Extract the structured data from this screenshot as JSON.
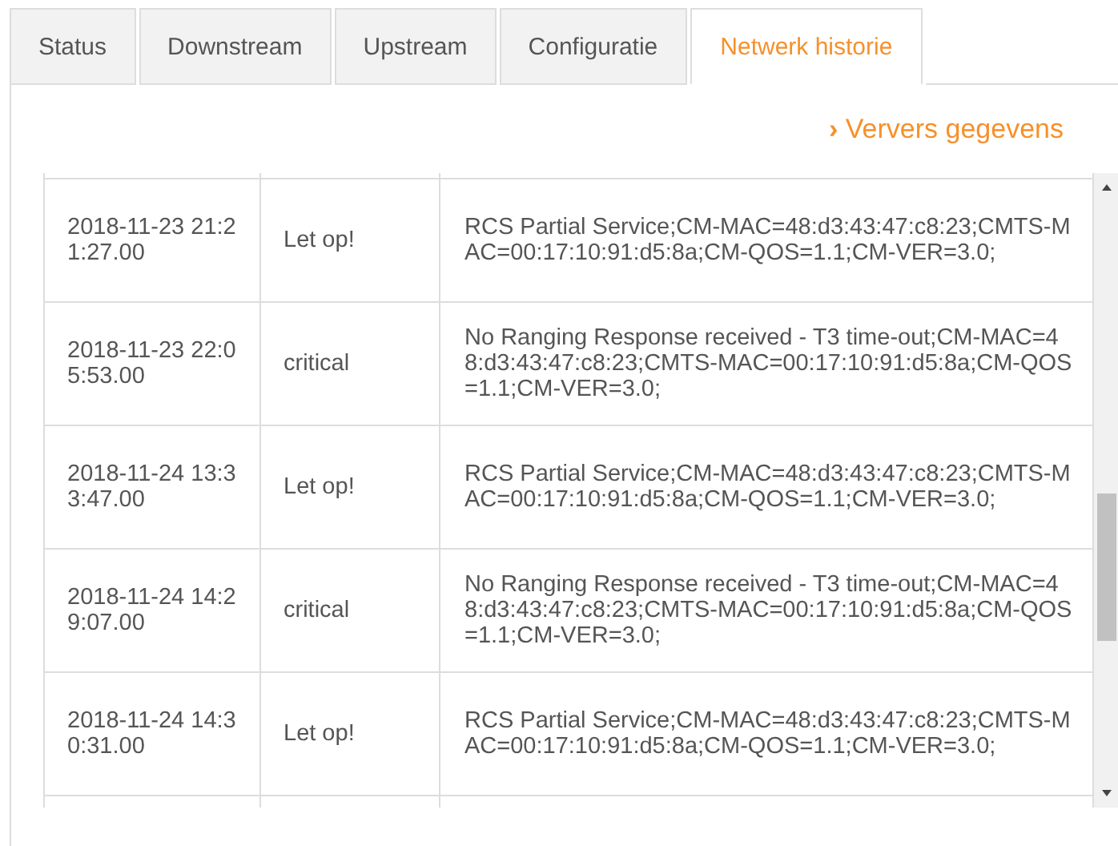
{
  "tabs": [
    {
      "label": "Status",
      "selected": false
    },
    {
      "label": "Downstream",
      "selected": false
    },
    {
      "label": "Upstream",
      "selected": false
    },
    {
      "label": "Configuratie",
      "selected": false
    },
    {
      "label": "Netwerk historie",
      "selected": true
    }
  ],
  "refresh_link": {
    "icon": "›",
    "label": "Ververs gegevens"
  },
  "table": {
    "rows": [
      {
        "time": "2018-11-23 21:21:27.00",
        "level": "Let op!",
        "message": "RCS Partial Service;CM-MAC=48:d3:43:47:c8:23;CMTS-MAC=00:17:10:91:d5:8a;CM-QOS=1.1;CM-VER=3.0;"
      },
      {
        "time": "2018-11-23 22:05:53.00",
        "level": "critical",
        "message": "No Ranging Response received - T3 time-out;CM-MAC=48:d3:43:47:c8:23;CMTS-MAC=00:17:10:91:d5:8a;CM-QOS=1.1;CM-VER=3.0;"
      },
      {
        "time": "2018-11-24 13:33:47.00",
        "level": "Let op!",
        "message": "RCS Partial Service;CM-MAC=48:d3:43:47:c8:23;CMTS-MAC=00:17:10:91:d5:8a;CM-QOS=1.1;CM-VER=3.0;"
      },
      {
        "time": "2018-11-24 14:29:07.00",
        "level": "critical",
        "message": "No Ranging Response received - T3 time-out;CM-MAC=48:d3:43:47:c8:23;CMTS-MAC=00:17:10:91:d5:8a;CM-QOS=1.1;CM-VER=3.0;"
      },
      {
        "time": "2018-11-24 14:30:31.00",
        "level": "Let op!",
        "message": "RCS Partial Service;CM-MAC=48:d3:43:47:c8:23;CMTS-MAC=00:17:10:91:d5:8a;CM-QOS=1.1;CM-VER=3.0;"
      }
    ]
  }
}
